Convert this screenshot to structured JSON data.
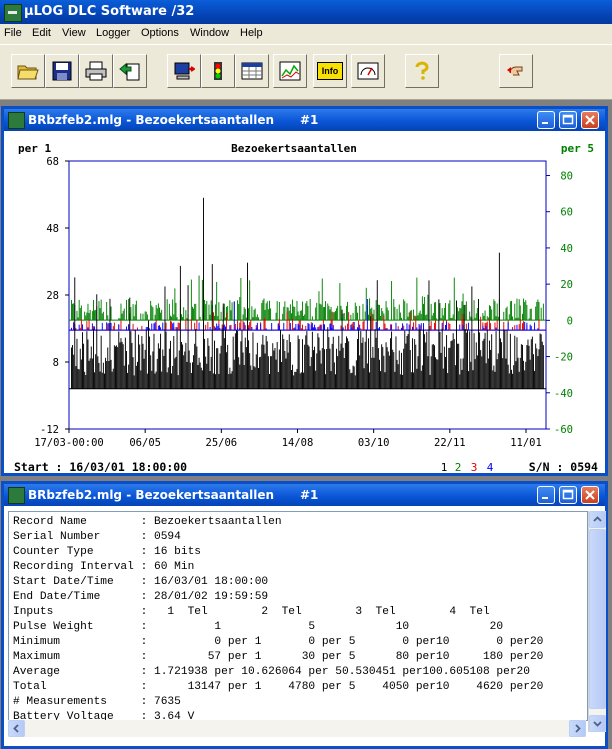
{
  "app": {
    "title": "µLOG DLC Software /32",
    "title_icon": "logger-app-icon"
  },
  "menu": [
    "File",
    "Edit",
    "View",
    "Logger",
    "Options",
    "Window",
    "Help"
  ],
  "toolbar": [
    {
      "name": "open-file-button",
      "icon": "folder-open-icon"
    },
    {
      "name": "save-button",
      "icon": "floppy-disk-icon"
    },
    {
      "name": "print-button",
      "icon": "printer-icon"
    },
    {
      "name": "export-button",
      "icon": "export-document-icon"
    },
    {
      "name": "read-logger-button",
      "icon": "computer-download-icon"
    },
    {
      "name": "status-light-button",
      "icon": "traffic-light-icon"
    },
    {
      "name": "data-table-button",
      "icon": "data-grid-icon"
    },
    {
      "name": "graph-button",
      "icon": "line-chart-icon"
    },
    {
      "name": "info-button",
      "icon": "info-label-icon",
      "label": "Info"
    },
    {
      "name": "gauge-button",
      "icon": "gauge-meter-icon"
    },
    {
      "name": "help-button",
      "icon": "question-help-icon"
    },
    {
      "name": "exit-button",
      "icon": "hand-exit-icon"
    }
  ],
  "chart_window": {
    "title": "BRbzfeb2.mlg - Bezoekertsaantallen",
    "number": "#1",
    "left_scale_label": "per 1",
    "right_scale_label": "per 5",
    "start_text": "Start : 16/03/01 18:00:00",
    "channels": [
      "1",
      "2",
      "3",
      "4"
    ],
    "serial_text": "S/N : 0594"
  },
  "chart_data": {
    "type": "bar",
    "title": "Bezoekertsaantallen",
    "x_tick_labels": [
      "17/03-00:00",
      "06/05",
      "25/06",
      "14/08",
      "03/10",
      "22/11",
      "11/01"
    ],
    "y_left": {
      "ylim": [
        -12,
        68
      ],
      "ticks": [
        68,
        48,
        28,
        8,
        -12
      ]
    },
    "y_right": {
      "ylim": [
        -60,
        88
      ],
      "ticks": [
        80,
        60,
        40,
        20,
        0,
        -20,
        -40,
        -60
      ]
    },
    "series": [
      {
        "name": "1",
        "color": "#000000",
        "axis": "left",
        "baseline": 0,
        "typical": [
          4,
          18
        ],
        "peak": 57
      },
      {
        "name": "2",
        "color": "#008000",
        "axis": "left",
        "baseline": 20.5,
        "typical": [
          21,
          27
        ],
        "peak": 37
      },
      {
        "name": "3",
        "color": "#e00000",
        "axis": "left",
        "baseline": 17.5,
        "typical": [
          18,
          21
        ],
        "peak": 24
      },
      {
        "name": "4",
        "color": "#0000ff",
        "axis": "left",
        "baseline": 17.5,
        "typical": [
          18,
          20
        ],
        "peak": 30
      }
    ],
    "grid": false,
    "legend": "bottom-right"
  },
  "info_window": {
    "title": "BRbzfeb2.mlg - Bezoekertsaantallen",
    "number": "#1",
    "rows": [
      {
        "label": "Record Name       ",
        "value": ": Bezoekertsaantallen"
      },
      {
        "label": "Serial Number     ",
        "value": ": 0594"
      },
      {
        "label": "Counter Type      ",
        "value": ": 16 bits"
      },
      {
        "label": "Recording Interval",
        "value": ": 60 Min"
      },
      {
        "label": "Start Date/Time   ",
        "value": ": 16/03/01 18:00:00"
      },
      {
        "label": "End Date/Time     ",
        "value": ": 28/01/02 19:59:59"
      },
      {
        "label": "Inputs            ",
        "value": ":   1  Tel        2  Tel        3  Tel        4  Tel"
      },
      {
        "label": "Pulse Weight      ",
        "value": ":          1             5            10            20"
      },
      {
        "label": "Minimum           ",
        "value": ":          0 per 1       0 per 5       0 per10       0 per20"
      },
      {
        "label": "Maximum           ",
        "value": ":         57 per 1      30 per 5      80 per10     180 per20"
      },
      {
        "label": "Average           ",
        "value": ": 1.721938 per 10.626064 per 50.530451 per100.605108 per20"
      },
      {
        "label": "Total             ",
        "value": ":      13147 per 1    4780 per 5    4050 per10    4620 per20"
      },
      {
        "label": "# Measurements    ",
        "value": ": 7635"
      },
      {
        "label": "Battery Voltage   ",
        "value": ": 3.64 V"
      }
    ]
  }
}
